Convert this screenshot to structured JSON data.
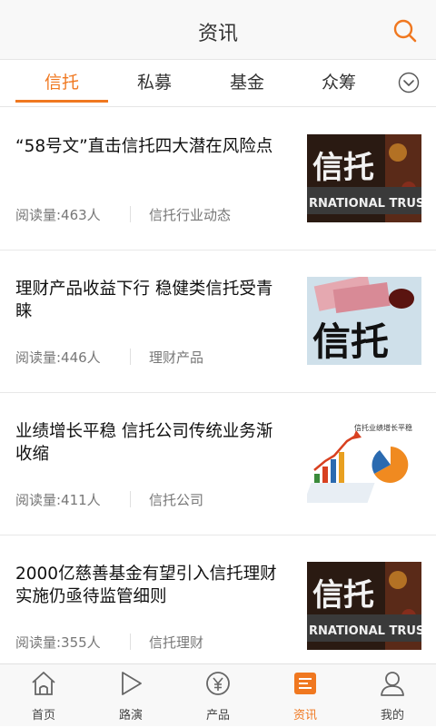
{
  "header": {
    "title": "资讯",
    "search_icon": "search-icon"
  },
  "tabs": [
    {
      "label": "信托",
      "active": true
    },
    {
      "label": "私募"
    },
    {
      "label": "基金"
    },
    {
      "label": "众筹"
    }
  ],
  "tabs_more_icon": "chevron-down-icon",
  "articles": [
    {
      "title": "“58号文”直击信托四大潜在风险点",
      "reads": "阅读量:463人",
      "category": "信托行业动态",
      "image_text": "信托"
    },
    {
      "title": "理财产品收益下行 稳健类信托受青睐",
      "reads": "阅读量:446人",
      "category": "理财产品",
      "image_text": "信托"
    },
    {
      "title": "业绩增长平稳 信托公司传统业务渐收缩",
      "reads": "阅读量:411人",
      "category": "信托公司",
      "image_text": "信托业绩增长平稳"
    },
    {
      "title": "2000亿慈善基金有望引入信托理财 实施仍亟待监管细则",
      "reads": "阅读量:355人",
      "category": "信托理财",
      "image_text": "信托"
    }
  ],
  "tabbar": [
    {
      "label": "首页",
      "icon": "home-icon"
    },
    {
      "label": "路演",
      "icon": "play-icon"
    },
    {
      "label": "产品",
      "icon": "product-icon"
    },
    {
      "label": "资讯",
      "icon": "news-icon",
      "active": true
    },
    {
      "label": "我的",
      "icon": "user-icon"
    }
  ],
  "colors": {
    "accent": "#f07820",
    "text": "#222222",
    "meta": "#777777"
  }
}
